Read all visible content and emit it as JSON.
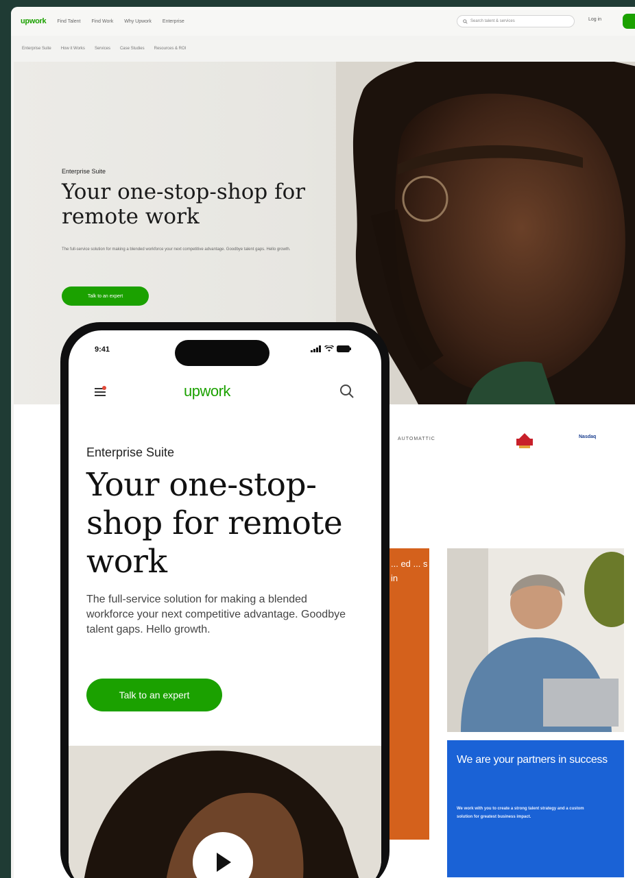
{
  "desktop": {
    "logo": "upwork",
    "nav": [
      "Find Talent",
      "Find Work",
      "Why Upwork",
      "Enterprise"
    ],
    "search_placeholder": "Search talent & services",
    "login": "Log in",
    "subnav": [
      "Enterprise Suite",
      "How it Works",
      "Services",
      "Case Studies",
      "Resources & ROI"
    ],
    "hero": {
      "eyebrow": "Enterprise Suite",
      "title": "Your one-stop-shop for remote work",
      "subtitle": "The full-service solution for making a blended workforce your next competitive advantage. Goodbye talent gaps. Hello growth.",
      "cta": "Talk to an expert"
    },
    "client_logos": [
      "AUTOMATTIC",
      "",
      "Nasdaq"
    ],
    "orange_card_text": "... ed ... s in",
    "blue_card": {
      "title": "We are your partners in success",
      "body": "We work with you to create a strong talent strategy and a custom solution for greatest business impact."
    }
  },
  "phone": {
    "time": "9:41",
    "logo": "upwork",
    "eyebrow": "Enterprise Suite",
    "title": "Your one-stop-shop for remote work",
    "subtitle": "The full-service solution for making a blended workforce your next competitive advantage. Goodbye talent gaps. Hello growth.",
    "cta": "Talk to an expert"
  },
  "colors": {
    "brand_green": "#1ba100",
    "orange": "#d4611c",
    "blue": "#1a62d6",
    "background": "#1f3b34"
  },
  "icons": [
    "hamburger-menu-icon",
    "search-icon",
    "signal-icon",
    "wifi-icon",
    "battery-icon",
    "play-icon"
  ]
}
